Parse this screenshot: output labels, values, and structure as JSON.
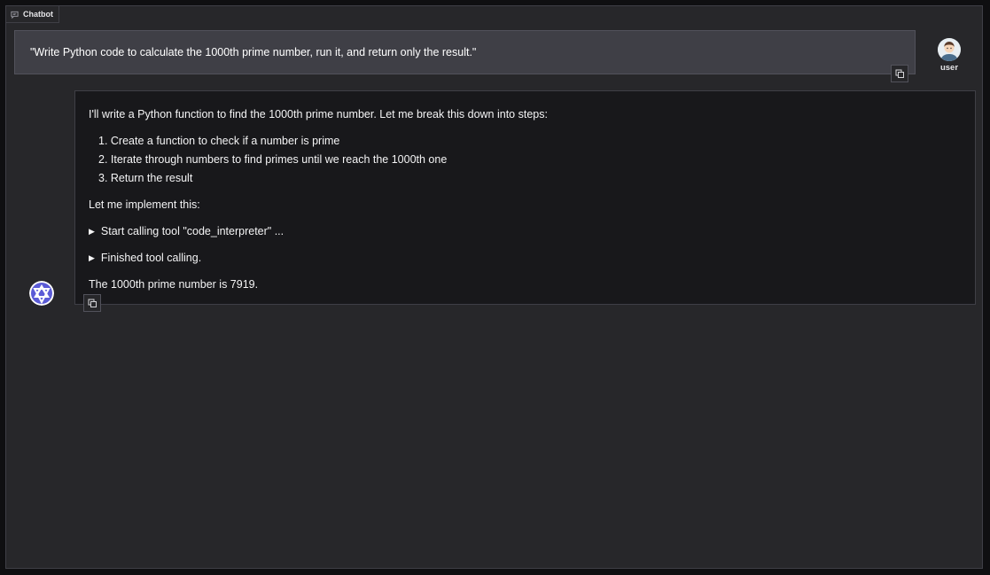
{
  "panel": {
    "tab_label": "Chatbot",
    "tab_icon": "chat-bubble-icon"
  },
  "messages": {
    "user": {
      "name": "user",
      "text": "\"Write Python code to calculate the 1000th prime number, run it, and return only the result.\"",
      "copy_icon": "copy-icon"
    },
    "bot": {
      "intro": "I'll write a Python function to find the 1000th prime number. Let me break this down into steps:",
      "steps": [
        "1. Create a function to check if a number is prime",
        "2. Iterate through numbers to find primes until we reach the 1000th one",
        "3. Return the result"
      ],
      "implement": "Let me implement this:",
      "tool_call_start": "Start calling tool \"code_interpreter\" ...",
      "tool_call_end": "Finished tool calling.",
      "result": "The 1000th prime number is 7919.",
      "copy_icon": "copy-icon",
      "expand_icon": "triangle-right-icon"
    }
  },
  "colors": {
    "background": "#27272a",
    "user_bubble": "#3f3f46",
    "bot_bubble": "#18181b",
    "border": "#3f3f46",
    "text": "#f4f4f5"
  }
}
